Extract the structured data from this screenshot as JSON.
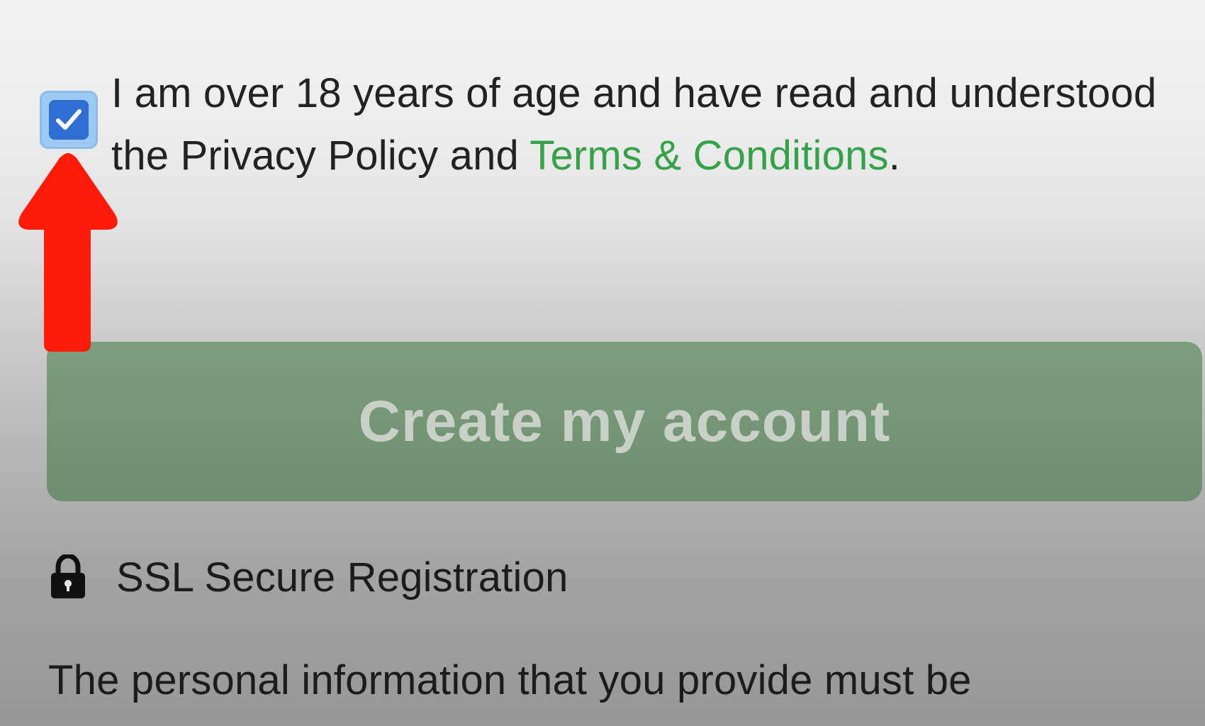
{
  "consent": {
    "checked": true,
    "text_before_link": "I am over 18 years of age and have read and understood the Privacy Policy and ",
    "terms_link": "Terms & Conditions",
    "text_after_link": "."
  },
  "primary_button": {
    "label": "Create my account"
  },
  "security": {
    "icon": "lock-icon",
    "label": "SSL Secure Registration"
  },
  "disclaimer": {
    "text": "The personal information that you provide must be"
  },
  "colors": {
    "checkbox": "#2f6fd4",
    "link": "#35a24a",
    "button_bg": "#779777",
    "annotation_arrow": "#ff1a0a"
  },
  "annotation": {
    "icon": "red-arrow-up-icon"
  }
}
